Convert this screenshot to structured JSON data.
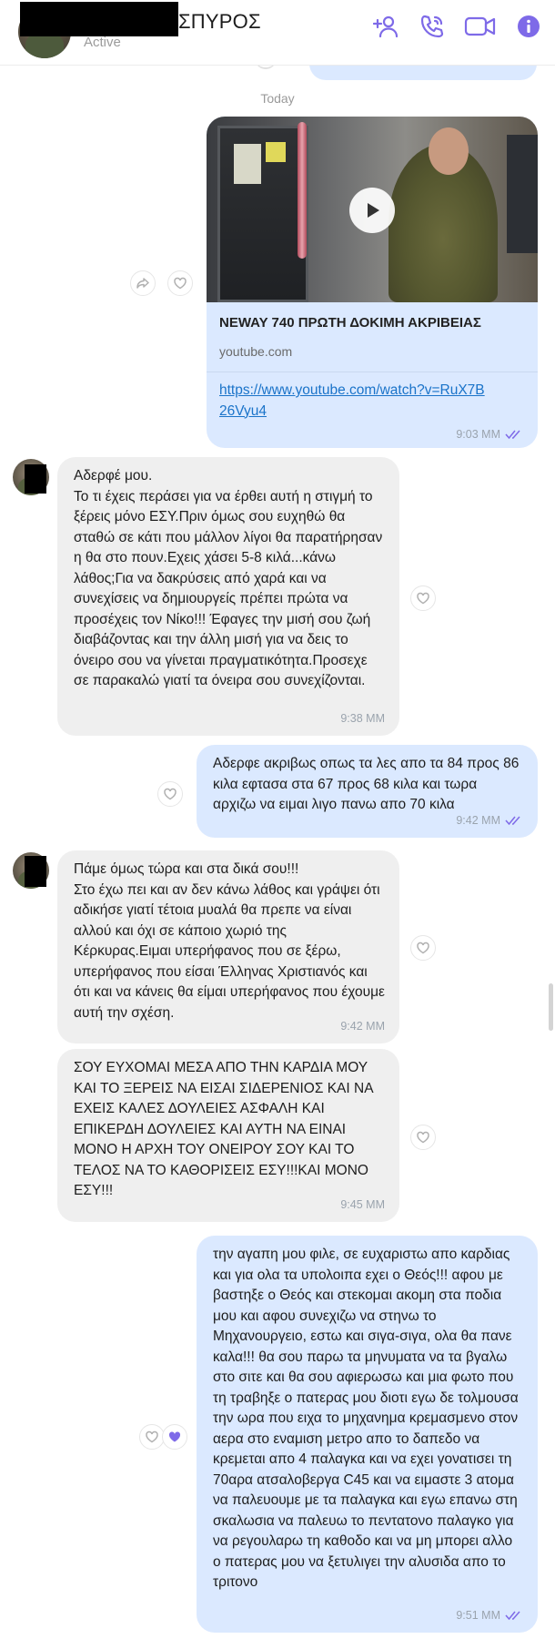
{
  "header": {
    "contact_name": "ΣΠΥΡΟΣ",
    "status": "Active",
    "icons": [
      "add-person-icon",
      "phone-call-icon",
      "video-call-icon",
      "info-icon"
    ],
    "accent_color": "#7e6ae8"
  },
  "day_separator": "Today",
  "link_card": {
    "title": "NEWAY 740 ΠΡΩΤΗ ΔΟΚΙΜΗ ΑΚΡΙΒΕΙΑΣ",
    "domain": "youtube.com",
    "url": "https://www.youtube.com/watch?v=RuX7B26Vyu4",
    "time": "9:03 MM"
  },
  "messages": [
    {
      "direction": "incoming",
      "text": "Αδερφέ μου.\nΤο τι έχεις περάσει για να έρθει αυτή η στιγμή το ξέρεις μόνο ΕΣΥ.Πριν όμως σου ευχηθώ θα σταθώ σε κάτι που μάλλον λίγοι θα παρατήρησαν η θα στο πουν.Εχεις χάσει 5-8 κιλά...κάνω λάθος;Για να δακρύσεις από χαρά και να συνεχίσεις να δημιουργείς πρέπει πρώτα να προσέχεις τον Νίκο!!! Έφαγες την μισή σου ζωή διαβάζοντας και την άλλη μισή για να δεις το όνειρο σου να γίνεται πραγματικότητα.Προσεχε σε παρακαλώ γιατί τα όνειρα σου συνεχίζονται.",
      "time": "9:38 MM"
    },
    {
      "direction": "outgoing",
      "text": "Αδερφε ακριβως οπως τα λες απο τα 84 προς 86 κιλα εφτασα στα 67 προς 68 κιλα και τωρα αρχιζω να ειμαι λιγο πανω απο 70 κιλα",
      "time": "9:42 MM"
    },
    {
      "direction": "incoming",
      "text": "Πάμε όμως τώρα και στα δικά σου!!!\nΣτο έχω πει και αν δεν κάνω λάθος και γράψει ότι αδικήσε γιατί τέτοια μυαλά θα πρεπε να είναι αλλού και όχι σε κάποιο χωριό της Κέρκυρας.Ειμαι υπερήφανος που σε ξέρω, υπερήφανος που είσαι Έλληνας Χριστιανός και ότι και να κάνεις θα είμαι υπερήφανος που έχουμε αυτή την σχέση.",
      "time": "9:42 MM"
    },
    {
      "direction": "incoming",
      "text": "ΣΟΥ ΕΥΧΟΜΑΙ ΜΕΣΑ ΑΠΟ ΤΗΝ ΚΑΡΔΙΑ ΜΟΥ ΚΑΙ ΤΟ ΞΕΡΕΙΣ ΝΑ ΕΙΣΑΙ ΣΙΔΕΡΕΝΙΟΣ ΚΑΙ ΝΑ ΕΧΕΙΣ ΚΑΛΕΣ ΔΟΥΛΕΙΕΣ ΑΣΦΑΛΗ ΚΑΙ ΕΠΙΚΕΡΔΗ ΔΟΥΛΕΙΕΣ ΚΑΙ ΑΥΤΗ ΝΑ ΕΙΝΑΙ ΜΟΝΟ Η ΑΡΧΗ ΤΟΥ ΟΝΕΙΡΟΥ ΣΟΥ ΚΑΙ ΤΟ ΤΕΛΟΣ ΝΑ ΤΟ ΚΑΘΟΡΙΣΕΙΣ ΕΣΥ!!!ΚΑΙ ΜΟΝΟ ΕΣΥ!!!",
      "time": "9:45 MM"
    },
    {
      "direction": "outgoing",
      "text": "την αγαπη μου φιλε, σε ευχαριστω απο καρδιας και για ολα τα υπολοιπα εχει ο Θεός!!! αφου με βαστηξε ο Θεός και στεκομαι ακομη στα ποδια μου και αφου συνεχιζω να στηνω το Μηχανουργειο, εστω και σιγα-σιγα, ολα θα πανε καλα!!! θα σου παρω τα μηνυματα να τα βγαλω στο σιτε και θα σου αφιερωσω και μια φωτο που τη τραβηξε ο πατερας μου διοτι εγω δε τολμουσα την ωρα που ειχα το μηχανημα κρεμασμενο στον αερα στο εναμιση μετρο απο το δαπεδο να κρεμεται απο 4 παλαγκα και να εχει γονατισει τη 70αρα ατσαλοβεργα C45 και να ειμαστε 3 ατομα να παλευουμε με τα παλαγκα και εγω επανω στη σκαλωσια να παλευω το πεντατονο παλαγκο για να ρεγουλαρω τη καθοδο και να μη μπορει αλλο ο πατερας μου να ξετυλιγει την αλυσιδα απο το τριτονο",
      "time": "9:51 MM"
    }
  ]
}
